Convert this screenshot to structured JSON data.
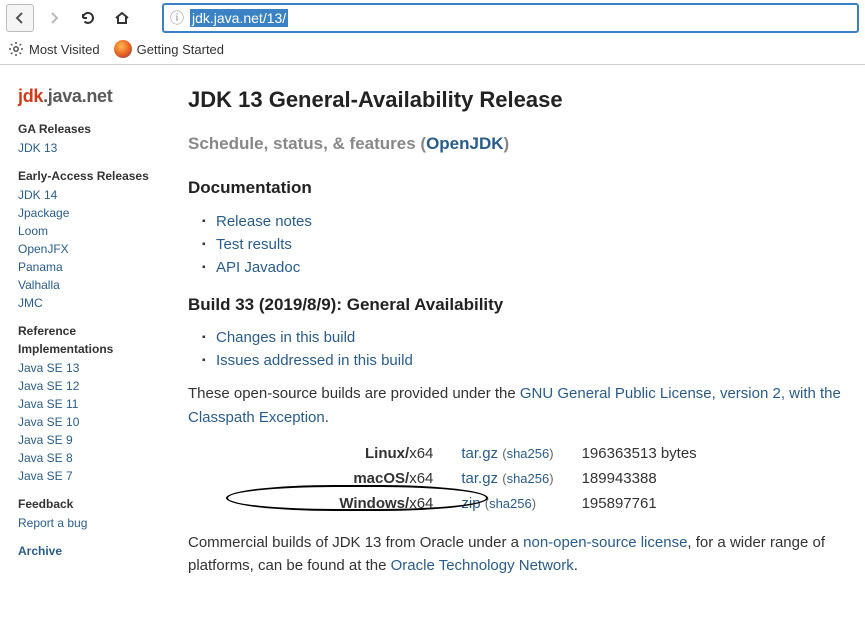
{
  "browser": {
    "url_display": "jdk.java.net/13/",
    "bookmarks": {
      "most_visited": "Most Visited",
      "getting_started": "Getting Started"
    }
  },
  "sidebar": {
    "logo_jdk": "jdk",
    "logo_rest": ".java.net",
    "sections": [
      {
        "heading": "GA Releases",
        "items": [
          "JDK 13"
        ]
      },
      {
        "heading": "Early-Access Releases",
        "items": [
          "JDK 14",
          "Jpackage",
          "Loom",
          "OpenJFX",
          "Panama",
          "Valhalla",
          "JMC"
        ]
      },
      {
        "heading": "Reference Implementations",
        "items": [
          "Java SE 13",
          "Java SE 12",
          "Java SE 11",
          "Java SE 10",
          "Java SE 9",
          "Java SE 8",
          "Java SE 7"
        ]
      },
      {
        "heading": "Feedback",
        "items": [
          "Report a bug"
        ]
      }
    ],
    "archive": "Archive"
  },
  "main": {
    "title": "JDK 13 General-Availability Release",
    "subtitle_prefix": "Schedule, status, & features (",
    "subtitle_link": "OpenJDK",
    "subtitle_suffix": ")",
    "doc_heading": "Documentation",
    "doc_links": [
      "Release notes",
      "Test results",
      "API Javadoc"
    ],
    "build_heading": "Build 33 (2019/8/9): General Availability",
    "build_links": [
      "Changes in this build",
      "Issues addressed in this build"
    ],
    "license_p1a": "These open-source builds are provided under the ",
    "license_link": "GNU General Public License, version 2, with the Classpath Exception",
    "license_p1b": ".",
    "downloads": [
      {
        "os": "Linux",
        "arch": "x64",
        "fmt": "tar.gz",
        "size": "196363513 bytes"
      },
      {
        "os": "macOS",
        "arch": "x64",
        "fmt": "tar.gz",
        "size": "189943388"
      },
      {
        "os": "Windows",
        "arch": "x64",
        "fmt": "zip",
        "size": "195897761"
      }
    ],
    "sha_label": "sha256",
    "commercial_p1": "Commercial builds of JDK 13 from Oracle under a ",
    "commercial_link1": "non-open-source license",
    "commercial_p2": ", for a wider range of platforms, can be found at the ",
    "commercial_link2": "Oracle Technology Network",
    "commercial_p3": "."
  }
}
